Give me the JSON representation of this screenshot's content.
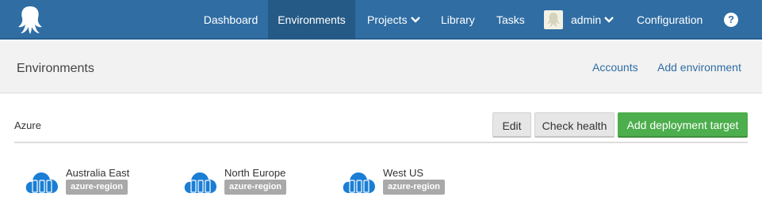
{
  "nav": {
    "items": [
      {
        "label": "Dashboard"
      },
      {
        "label": "Environments",
        "active": true
      },
      {
        "label": "Projects",
        "dropdown": true
      },
      {
        "label": "Library"
      },
      {
        "label": "Tasks"
      },
      {
        "label": "admin",
        "dropdown": true
      },
      {
        "label": "Configuration"
      }
    ],
    "help_glyph": "?",
    "logo_icon": "octopus-logo-icon",
    "avatar_icon": "user-avatar-icon"
  },
  "header": {
    "title": "Environments",
    "links": [
      "Accounts",
      "Add environment"
    ]
  },
  "environment": {
    "name": "Azure",
    "actions": {
      "edit": "Edit",
      "check_health": "Check health",
      "add_target": "Add deployment target"
    },
    "machines": [
      {
        "name": "Australia East",
        "tag": "azure-region",
        "icon": "azure-cloud-icon"
      },
      {
        "name": "North Europe",
        "tag": "azure-region",
        "icon": "azure-cloud-icon"
      },
      {
        "name": "West US",
        "tag": "azure-region",
        "icon": "azure-cloud-icon"
      }
    ]
  },
  "colors": {
    "nav_bg": "#2f6da3",
    "nav_active": "#245a85",
    "accent_green": "#4cae4c",
    "tag_grey": "#a9a9a9",
    "link_blue": "#2f6da3",
    "cloud_blue": "#1a7ed4"
  }
}
